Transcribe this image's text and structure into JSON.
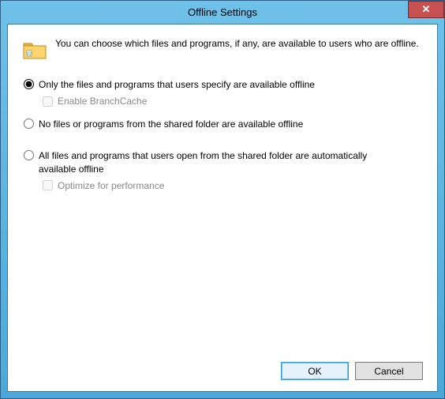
{
  "window": {
    "title": "Offline Settings",
    "description": "You can choose which files and programs, if any, are available to users who are offline."
  },
  "options": {
    "radio1": "Only the files and programs that users specify are available offline",
    "check1": "Enable BranchCache",
    "radio2": "No files or programs from the shared folder are available offline",
    "radio3": "All files and programs that users open from the shared folder are automatically available offline",
    "check2": "Optimize for performance"
  },
  "buttons": {
    "ok": "OK",
    "cancel": "Cancel"
  }
}
